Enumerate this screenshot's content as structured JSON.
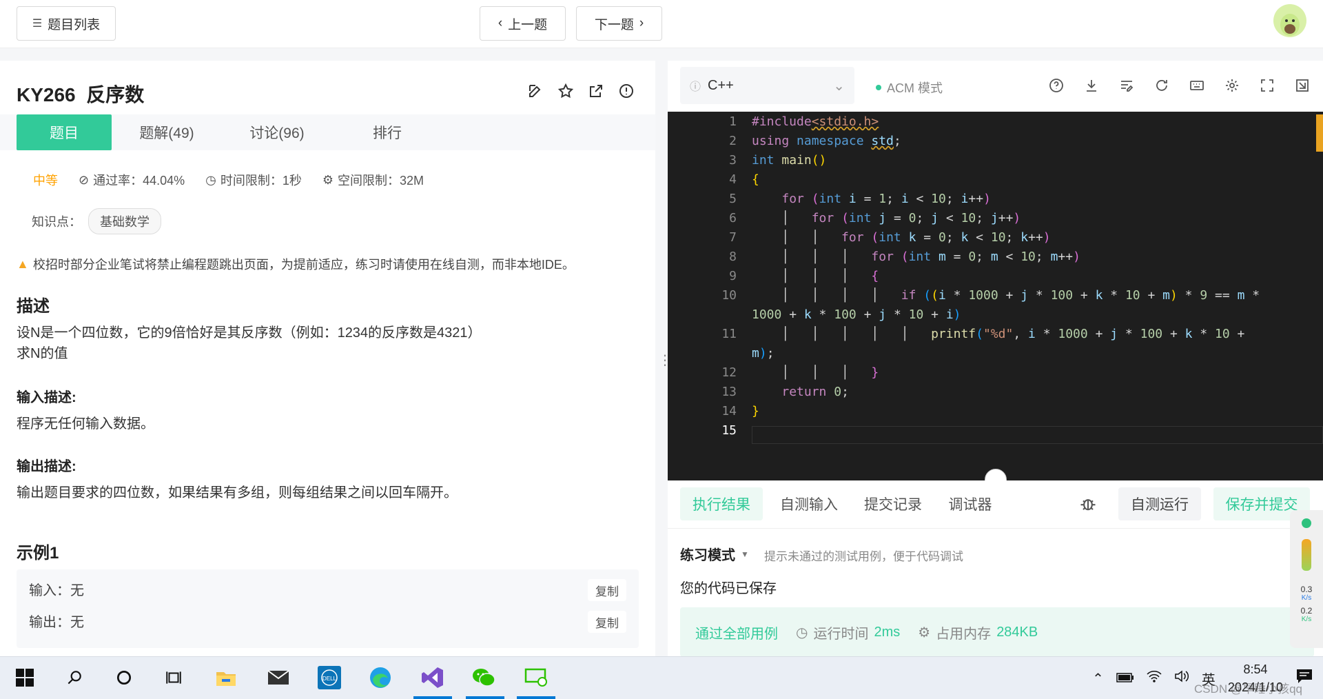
{
  "topbar": {
    "problem_list": "题目列表",
    "prev": "上一题",
    "next": "下一题"
  },
  "problem": {
    "id": "KY266",
    "title": "反序数",
    "tabs": [
      "题目",
      "题解(49)",
      "讨论(96)",
      "排行"
    ],
    "difficulty": "中等",
    "pass_rate": "通过率：44.04%",
    "time_limit": "时间限制：1秒",
    "memory_limit": "空间限制：32M",
    "knowledge_label": "知识点：",
    "knowledge_tag": "基础数学",
    "warning": "校招时部分企业笔试将禁止编程题跳出页面，为提前适应，练习时请使用在线自测，而非本地IDE。",
    "desc_heading": "描述",
    "desc_line1": "设N是一个四位数，它的9倍恰好是其反序数（例如：1234的反序数是4321）",
    "desc_line2": "求N的值",
    "input_heading": "输入描述:",
    "input_text": "程序无任何输入数据。",
    "output_heading": "输出描述:",
    "output_text": "输出题目要求的四位数，如果结果有多组，则每组结果之间以回车隔开。",
    "example_heading": "示例1",
    "example_input": "输入：无",
    "example_output": "输出：无",
    "copy_label": "复制"
  },
  "editor": {
    "language": "C++",
    "mode": "ACM 模式",
    "line_numbers": [
      "1",
      "2",
      "3",
      "4",
      "5",
      "6",
      "7",
      "8",
      "9",
      "10",
      "",
      "11",
      "",
      "12",
      "13",
      "14",
      "15"
    ]
  },
  "result": {
    "tabs": [
      "执行结果",
      "自测输入",
      "提交记录",
      "调试器"
    ],
    "run_label": "自测运行",
    "submit_label": "保存并提交",
    "mode_label": "练习模式",
    "mode_tip": "提示未通过的测试用例，便于代码调试",
    "saved_msg": "您的代码已保存",
    "pass_all": "通过全部用例",
    "run_time_label": "运行时间",
    "run_time": "2ms",
    "memory_label": "占用内存",
    "memory": "284KB"
  },
  "net_widget": {
    "up": "0.3",
    "down": "0.2",
    "unit": "K/s"
  },
  "taskbar": {
    "ime": "英",
    "time": "8:54",
    "date": "2024/1/10",
    "watermark": "CSDN @早睡小孩qq"
  }
}
